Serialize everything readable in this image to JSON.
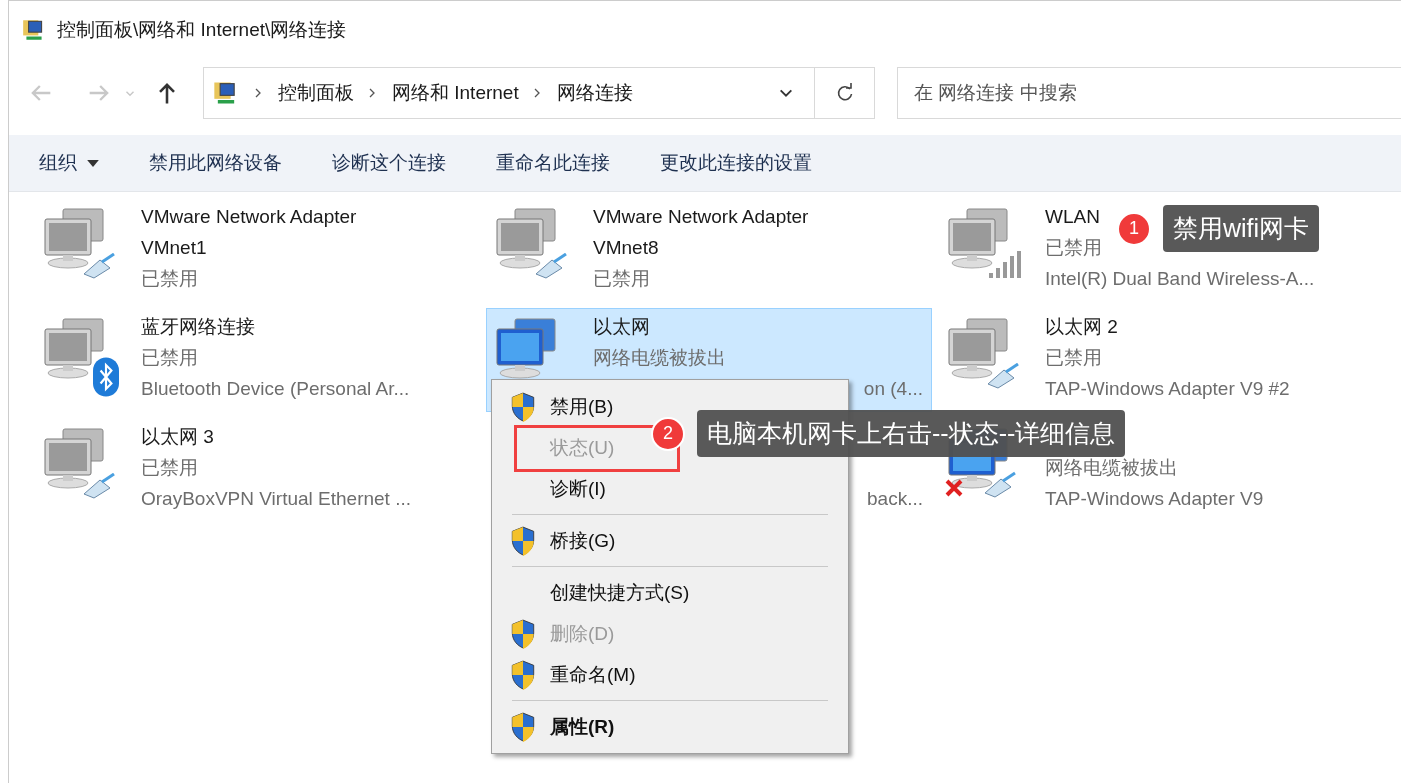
{
  "window": {
    "title": "控制面板\\网络和 Internet\\网络连接"
  },
  "nav": {
    "back_disabled": true,
    "forward_disabled": true,
    "breadcrumbs": [
      "控制面板",
      "网络和 Internet",
      "网络连接"
    ],
    "search": {
      "placeholder": "在 网络连接 中搜索"
    }
  },
  "toolbar": [
    {
      "label": "组织",
      "dropdown": true
    },
    {
      "label": "禁用此网络设备",
      "dropdown": false
    },
    {
      "label": "诊断这个连接",
      "dropdown": false
    },
    {
      "label": "重命名此连接",
      "dropdown": false
    },
    {
      "label": "更改此连接的设置",
      "dropdown": false
    }
  ],
  "adapters": [
    {
      "name": "VMware Network Adapter VMnet1",
      "status": "已禁用",
      "disabled": true,
      "kind": "cable",
      "selected": false
    },
    {
      "name": "VMware Network Adapter VMnet8",
      "status": "已禁用",
      "disabled": true,
      "kind": "cable",
      "selected": false
    },
    {
      "name": "WLAN",
      "status": "已禁用",
      "device": "Intel(R) Dual Band Wireless-A...",
      "disabled": true,
      "kind": "signal",
      "selected": false
    },
    {
      "name": "蓝牙网络连接",
      "status": "已禁用",
      "device": "Bluetooth Device (Personal Ar...",
      "disabled": true,
      "kind": "bluetooth",
      "selected": false
    },
    {
      "name": "以太网",
      "status": "网络电缆被拔出",
      "device": "on (4...",
      "device_covered_start": true,
      "disabled": false,
      "selected": true
    },
    {
      "name": "以太网 2",
      "status": "已禁用",
      "device": "TAP-Windows Adapter V9 #2",
      "disabled": true,
      "kind": "cable",
      "selected": false
    },
    {
      "name": "以太网 3",
      "status": "已禁用",
      "device": "OrayBoxVPN Virtual Ethernet ...",
      "disabled": true,
      "kind": "cable",
      "selected": false
    },
    {
      "device": "back...",
      "device_covered_start": true,
      "selected": false
    },
    {
      "status": "网络电缆被拔出",
      "device": "TAP-Windows Adapter V9",
      "disabled": false,
      "kind": "cable-x",
      "selected": false
    }
  ],
  "context_menu": [
    {
      "kind": "item",
      "label": "禁用(B)",
      "shield": true,
      "disabled": false,
      "bold": false
    },
    {
      "kind": "item",
      "label": "状态(U)",
      "shield": false,
      "disabled": true,
      "bold": false
    },
    {
      "kind": "item",
      "label": "诊断(I)",
      "shield": false,
      "disabled": false,
      "bold": false
    },
    {
      "kind": "separator"
    },
    {
      "kind": "item",
      "label": "桥接(G)",
      "shield": true,
      "disabled": false,
      "bold": false
    },
    {
      "kind": "separator"
    },
    {
      "kind": "item",
      "label": "创建快捷方式(S)",
      "shield": false,
      "disabled": false,
      "bold": false
    },
    {
      "kind": "item",
      "label": "删除(D)",
      "shield": true,
      "disabled": true,
      "bold": false
    },
    {
      "kind": "item",
      "label": "重命名(M)",
      "shield": true,
      "disabled": false,
      "bold": false
    },
    {
      "kind": "separator"
    },
    {
      "kind": "item",
      "label": "属性(R)",
      "shield": true,
      "disabled": false,
      "bold": true
    }
  ],
  "annotations": [
    {
      "number": "1",
      "text": "禁用wifi网卡"
    },
    {
      "number": "2",
      "text": "电脑本机网卡上右击--状态--详细信息"
    }
  ]
}
